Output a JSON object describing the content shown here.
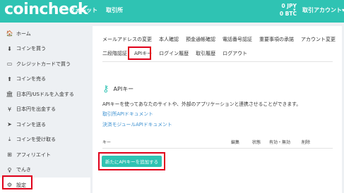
{
  "header": {
    "logo": "coincheck",
    "nav": [
      "ウォレット",
      "取引所"
    ],
    "balance_jpy": "0 JPY",
    "balance_btc": "0 BTC",
    "balance_caret": "▾",
    "account_label": "取引アカウント▾",
    "brand_color": "#2fc3b3"
  },
  "sidebar": {
    "items": [
      {
        "icon": "home-icon",
        "glyph": "🏠",
        "label": "ホーム"
      },
      {
        "icon": "cloud-download-icon",
        "glyph": "⬇",
        "label": "コインを買う"
      },
      {
        "icon": "credit-card-icon",
        "glyph": "▭",
        "label": "クレジットカードで買う"
      },
      {
        "icon": "cloud-upload-icon",
        "glyph": "⬆",
        "label": "コインを売る"
      },
      {
        "icon": "bank-icon",
        "glyph": "🏛",
        "label": "日本円/USドルを入金する"
      },
      {
        "icon": "yen-icon",
        "glyph": "¥",
        "label": "日本円を出金する"
      },
      {
        "icon": "send-icon",
        "glyph": "➤",
        "label": "コインを送る"
      },
      {
        "icon": "receive-icon",
        "glyph": "⤓",
        "label": "コインを受け取る"
      },
      {
        "icon": "affiliate-icon",
        "glyph": "⊞",
        "label": "アフィリエイト"
      },
      {
        "icon": "lightbulb-icon",
        "glyph": "♀",
        "label": "でんき"
      },
      {
        "icon": "gear-icon",
        "glyph": "⚙",
        "label": "設定"
      }
    ],
    "active_index": 10
  },
  "tabs": {
    "row1": [
      "メールアドレスの変更",
      "本人確認",
      "預金通帳確認",
      "電話番号認証",
      "重要事項の承諾",
      "アカウント変更"
    ],
    "row2": [
      "二段階認証",
      "APIキー",
      "ログイン履歴",
      "取引履歴",
      "ログアウト"
    ],
    "active": "APIキー"
  },
  "api": {
    "title": "APIキー",
    "description": "APIキーを使ってあなたのサイトや、外部のアプリケーションと連携させることができます。",
    "link_exchange_doc": "取引所APIドキュメント",
    "link_payment_doc": "決済モジュールAPIドキュメント",
    "table_headers": {
      "key": "キー",
      "edit": "編集",
      "status": "状態",
      "valid": "有効・無効",
      "delete": "削除"
    },
    "add_button": "新たにAPIキーを追加する"
  },
  "highlight_color": "#e0001a"
}
